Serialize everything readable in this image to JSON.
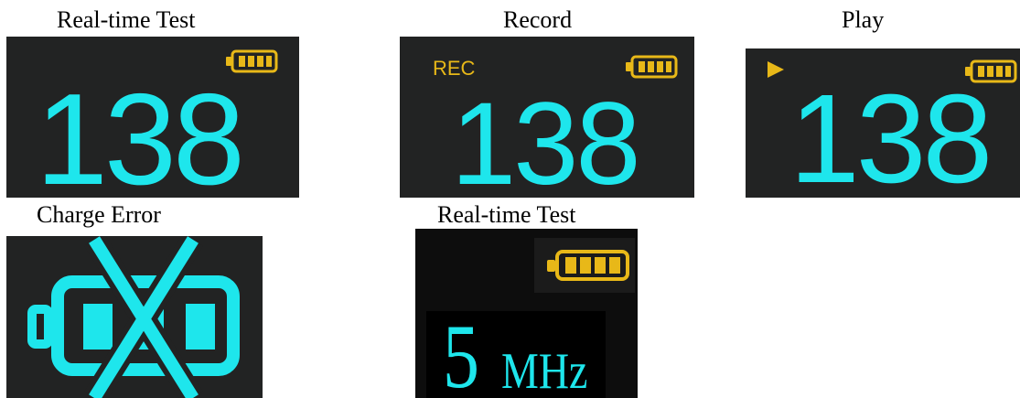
{
  "colors": {
    "screen_background": "#222323",
    "digit_color": "#1ee6ec",
    "indicator_color": "#e8b818",
    "caption_color": "#000000"
  },
  "panels": [
    {
      "caption": "Real-time Test",
      "reading": "138",
      "icons": [
        "battery-full-icon"
      ]
    },
    {
      "caption": "Record",
      "reading": "138",
      "mode_label": "REC",
      "icons": [
        "battery-full-icon"
      ]
    },
    {
      "caption": "Play",
      "reading": "138",
      "icons": [
        "play-icon",
        "battery-full-icon"
      ]
    },
    {
      "caption": "Charge Error",
      "icons": [
        "battery-crossed-icon"
      ]
    },
    {
      "caption": "Real-time Test",
      "reading": "5",
      "unit": "MHz",
      "icons": [
        "battery-full-icon"
      ]
    }
  ]
}
